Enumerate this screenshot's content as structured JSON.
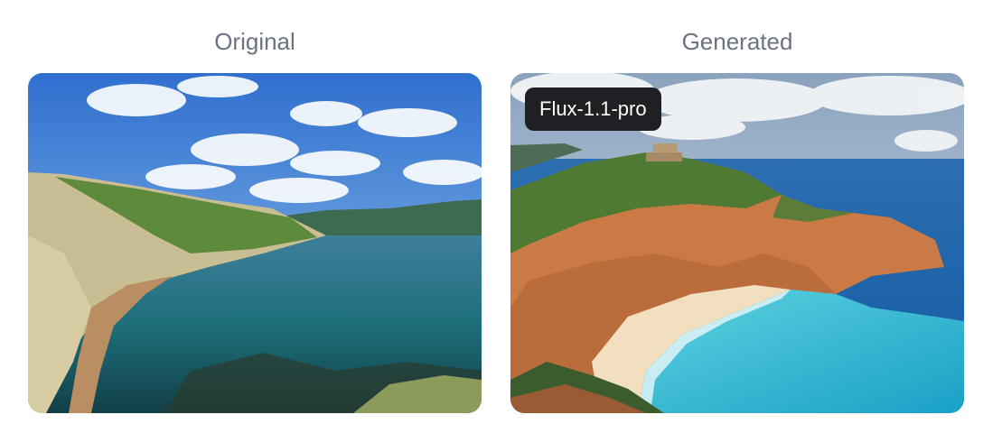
{
  "panels": {
    "original": {
      "caption": "Original",
      "image": "coastal bay with grassy hills, turquoise water and blue sky with clouds"
    },
    "generated": {
      "caption": "Generated",
      "model_badge": "Flux-1.1-pro",
      "image": "rocky orange cliffs with fortress, sandy cove beach and turquoise sea"
    }
  }
}
